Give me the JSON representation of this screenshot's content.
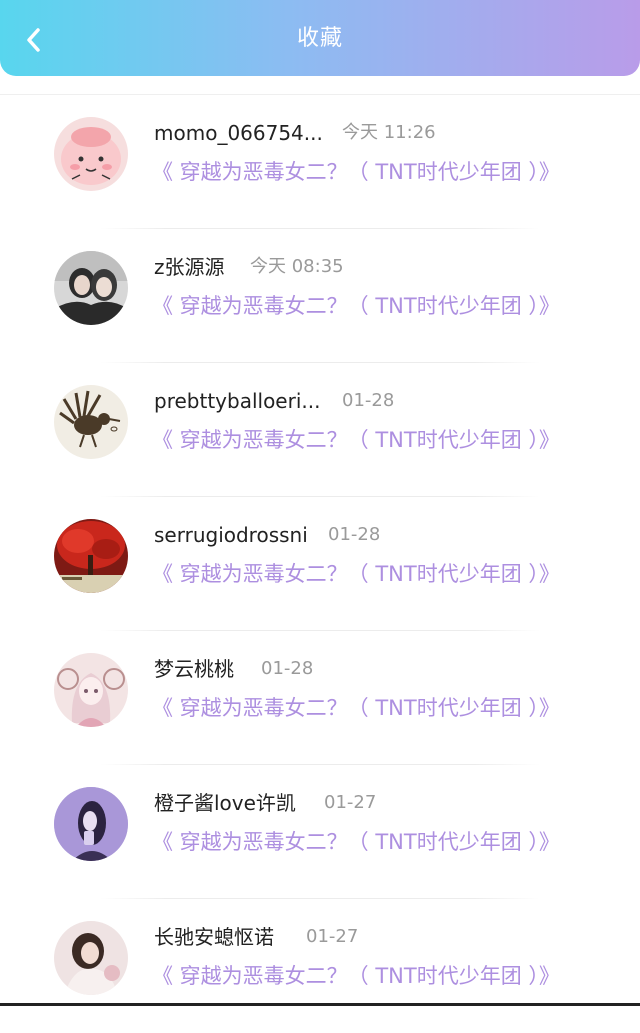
{
  "header": {
    "title": "收藏",
    "gradient": [
      "#58d6ee",
      "#8cbcf2",
      "#b99ce9"
    ]
  },
  "colors": {
    "book_link": "#ad8fe0",
    "name": "#222222",
    "time": "#9a9a9a"
  },
  "items": [
    {
      "name": "momo_066754...",
      "time": "今天 11:26",
      "book": "《 穿越为恶毒女二？（ TNT时代少年团 ）》",
      "avatar": "pink-cartoon-avatar"
    },
    {
      "name": "z张源源",
      "time": "今天 08:35",
      "book": "《 穿越为恶毒女二？（ TNT时代少年团 ）》",
      "avatar": "photo-avatar"
    },
    {
      "name": "prebttyballoeri...",
      "time": "01-28",
      "book": "《 穿越为恶毒女二？（ TNT时代少年团 ）》",
      "avatar": "bird-sketch-avatar"
    },
    {
      "name": "serrugiodrossni",
      "time": "01-28",
      "book": "《 穿越为恶毒女二？（ TNT时代少年团 ）》",
      "avatar": "red-tree-avatar"
    },
    {
      "name": "梦云桃桃",
      "time": "01-28",
      "book": "《 穿越为恶毒女二？（ TNT时代少年团 ）》",
      "avatar": "anime-girl-avatar"
    },
    {
      "name": "橙子酱love许凯",
      "time": "01-27",
      "book": "《 穿越为恶毒女二？（ TNT时代少年团 ）》",
      "avatar": "purple-photo-avatar"
    },
    {
      "name": "长驰安螅怄诺",
      "time": "01-27",
      "book": "《 穿越为恶毒女二？（ TNT时代少年团 ）》",
      "avatar": "girl-photo-avatar"
    }
  ]
}
